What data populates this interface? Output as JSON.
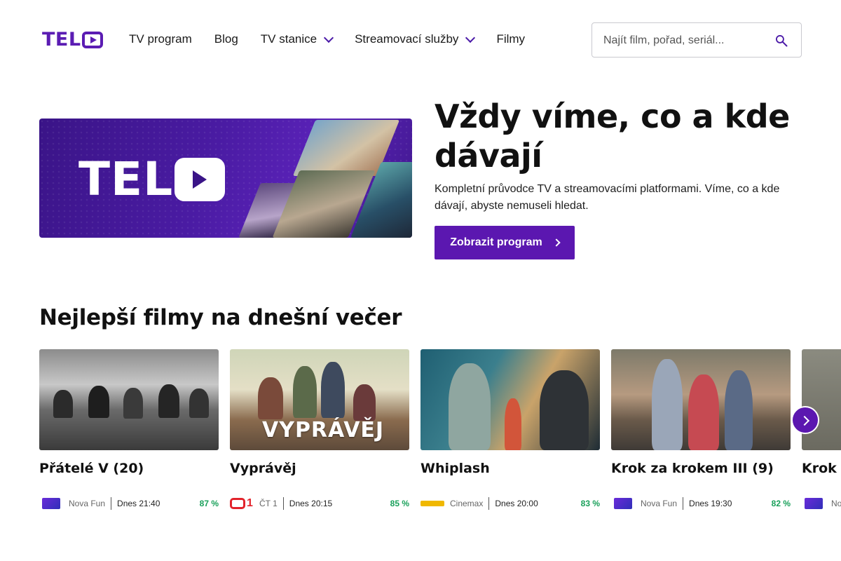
{
  "header": {
    "logo_text": "TEL",
    "nav": [
      {
        "label": "TV program",
        "has_dropdown": false
      },
      {
        "label": "Blog",
        "has_dropdown": false
      },
      {
        "label": "TV stanice",
        "has_dropdown": true
      },
      {
        "label": "Streamovací služby",
        "has_dropdown": true
      },
      {
        "label": "Filmy",
        "has_dropdown": false
      }
    ],
    "search": {
      "placeholder": "Najít film, pořad, seriál...",
      "value": "",
      "icon": "search-icon"
    }
  },
  "hero": {
    "banner_logo_text": "TEL",
    "title": "Vždy víme, co a kde dávají",
    "subtitle": "Kompletní průvodce TV a streamovacími platformami. Víme, co a kde dávají, abyste nemuseli hledat.",
    "cta_label": "Zobrazit program"
  },
  "section": {
    "title": "Nejlepší filmy na dnešní večer",
    "cards": [
      {
        "title": "Přátelé V (20)",
        "channel": "Nova Fun",
        "time": "Dnes 21:40",
        "score": "87 %"
      },
      {
        "title": "Vyprávěj",
        "channel": "ČT 1",
        "time": "Dnes 20:15",
        "score": "85 %",
        "thumb_text": "VYPRÁVĚJ"
      },
      {
        "title": "Whiplash",
        "channel": "Cinemax",
        "time": "Dnes 20:00",
        "score": "83 %"
      },
      {
        "title": "Krok za krokem III (9)",
        "channel": "Nova Fun",
        "time": "Dnes 19:30",
        "score": "82 %"
      },
      {
        "title": "Krok za krokem",
        "channel": "Nova Fun",
        "time": "",
        "score": ""
      }
    ]
  },
  "colors": {
    "brand": "#5b17b0",
    "score": "#19a05a"
  }
}
